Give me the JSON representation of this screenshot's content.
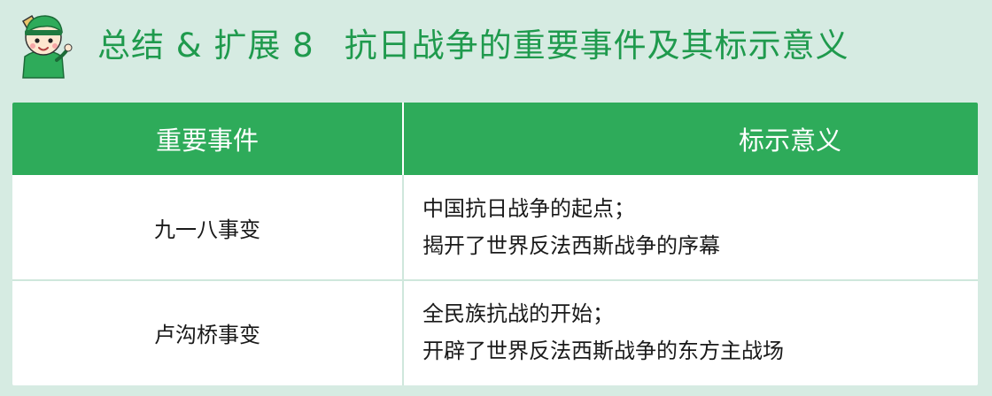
{
  "header": {
    "tag": "总结 & 扩展 8",
    "title": "抗日战争的重要事件及其标示意义"
  },
  "table": {
    "columns": [
      "重要事件",
      "标示意义"
    ],
    "rows": [
      {
        "event": "九一八事变",
        "significance": [
          "中国抗日战争的起点；",
          "揭开了世界反法西斯战争的序幕"
        ]
      },
      {
        "event": "卢沟桥事变",
        "significance": [
          "全民族抗战的开始；",
          "开辟了世界反法西斯战争的东方主战场"
        ]
      }
    ]
  },
  "colors": {
    "accent": "#2eab5a",
    "title": "#1f9a4d",
    "background": "#d6ebe2"
  },
  "icons": [
    "student-mascot-icon"
  ]
}
